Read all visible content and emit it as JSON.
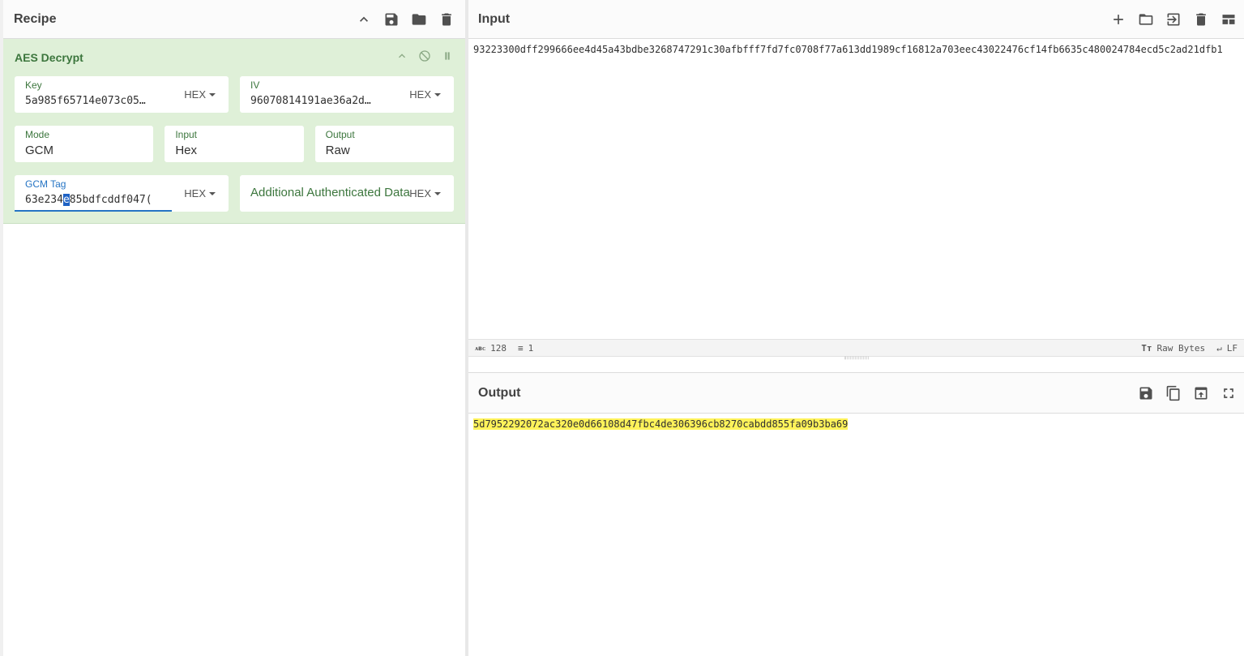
{
  "recipe": {
    "title": "Recipe",
    "icons": [
      "chevron-up-icon",
      "save-icon",
      "folder-icon",
      "trash-icon"
    ]
  },
  "operation": {
    "name": "AES Decrypt",
    "key": {
      "label": "Key",
      "value": "5a985f65714e073c05…",
      "format": "HEX"
    },
    "iv": {
      "label": "IV",
      "value": "96070814191ae36a2d…",
      "format": "HEX"
    },
    "mode": {
      "label": "Mode",
      "value": "GCM"
    },
    "input": {
      "label": "Input",
      "value": "Hex"
    },
    "output": {
      "label": "Output",
      "value": "Raw"
    },
    "gcm_tag": {
      "label": "GCM Tag",
      "value_pre": "63e234",
      "value_sel": "e",
      "value_post": "85bdfcddf047(",
      "format": "HEX"
    },
    "aad": {
      "placeholder": "Additional Authenticated Data",
      "format": "HEX"
    }
  },
  "input_pane": {
    "title": "Input",
    "text": "93223300dff299666ee4d45a43bdbe3268747291c30afbfff7fd7fc0708f77a613dd1989cf16812a703eec43022476cf14fb6635c480024784ecd5c2ad21dfb1",
    "status": {
      "length": "128",
      "lines": "1",
      "encoding": "Raw Bytes",
      "eol": "LF"
    }
  },
  "output_pane": {
    "title": "Output",
    "text": "5d7952292072ac320e0d66108d47fbc4de306396cb8270cabdd855fa09b3ba69"
  }
}
